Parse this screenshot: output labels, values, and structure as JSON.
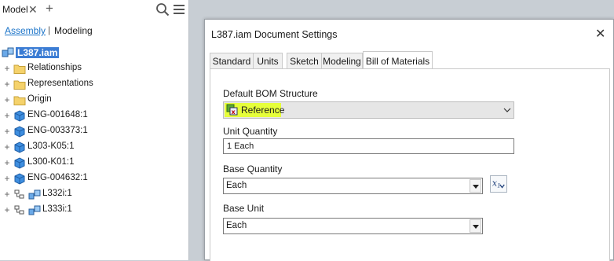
{
  "browser": {
    "title": "Model",
    "tabs": {
      "assembly": "Assembly",
      "modeling": "Modeling"
    },
    "tree": [
      {
        "label": "L387.iam",
        "icon": "assembly-icon",
        "expand": "",
        "root": true
      },
      {
        "label": "Relationships",
        "icon": "folder-icon",
        "expand": "+"
      },
      {
        "label": "Representations",
        "icon": "folder-icon",
        "expand": "+"
      },
      {
        "label": "Origin",
        "icon": "folder-icon",
        "expand": "+"
      },
      {
        "label": "ENG-001648:1",
        "icon": "part-icon",
        "expand": "+"
      },
      {
        "label": "ENG-003373:1",
        "icon": "part-icon",
        "expand": "+"
      },
      {
        "label": "L303-K05:1",
        "icon": "part-icon",
        "expand": "+"
      },
      {
        "label": "L300-K01:1",
        "icon": "part-icon",
        "expand": "+"
      },
      {
        "label": "ENG-004632:1",
        "icon": "part-icon",
        "expand": "+"
      },
      {
        "label": "L332i:1",
        "icon": "subassembly-icon",
        "expand": "+"
      },
      {
        "label": "L333i:1",
        "icon": "subassembly-icon",
        "expand": "+"
      }
    ]
  },
  "dialog": {
    "title": "L387.iam Document Settings",
    "tabs": [
      "Standard",
      "Units",
      "Sketch",
      "Modeling",
      "Bill of Materials"
    ],
    "active_tab": "Bill of Materials",
    "bom_structure_label": "Default BOM Structure",
    "bom_structure_value": "Reference",
    "unit_quantity_label": "Unit Quantity",
    "unit_quantity_value": "1 Each",
    "base_quantity_label": "Base Quantity",
    "base_quantity_value": "Each",
    "base_unit_label": "Base Unit",
    "base_unit_value": "Each"
  },
  "colors": {
    "selection": "#3c7dd4",
    "highlight": "#e6ff3a",
    "link": "#1a73c8"
  }
}
